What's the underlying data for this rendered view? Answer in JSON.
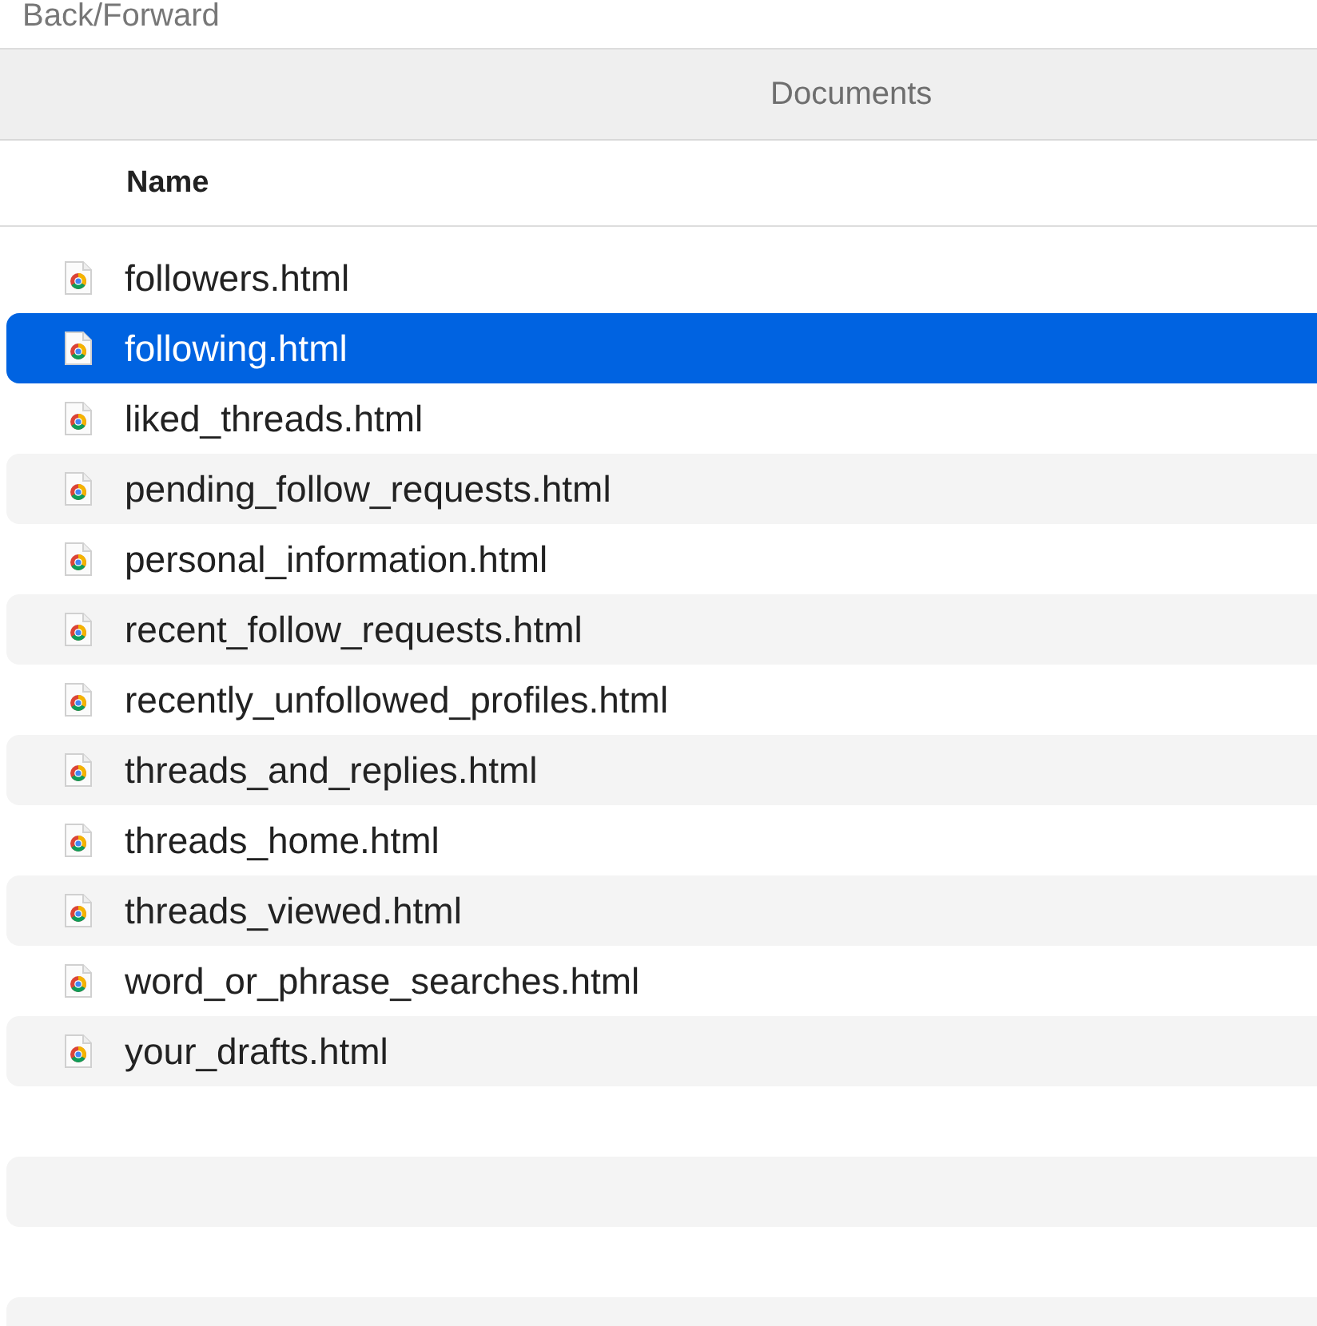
{
  "toolbar": {
    "label": "Back/Forward"
  },
  "window": {
    "title": "Documents"
  },
  "table": {
    "columns": [
      "Name"
    ],
    "rows": [
      {
        "name": "followers.html",
        "selected": false
      },
      {
        "name": "following.html",
        "selected": true
      },
      {
        "name": "liked_threads.html",
        "selected": false
      },
      {
        "name": "pending_follow_requests.html",
        "selected": false
      },
      {
        "name": "personal_information.html",
        "selected": false
      },
      {
        "name": "recent_follow_requests.html",
        "selected": false
      },
      {
        "name": "recently_unfollowed_profiles.html",
        "selected": false
      },
      {
        "name": "threads_and_replies.html",
        "selected": false
      },
      {
        "name": "threads_home.html",
        "selected": false
      },
      {
        "name": "threads_viewed.html",
        "selected": false
      },
      {
        "name": "word_or_phrase_searches.html",
        "selected": false
      },
      {
        "name": "your_drafts.html",
        "selected": false
      }
    ]
  }
}
